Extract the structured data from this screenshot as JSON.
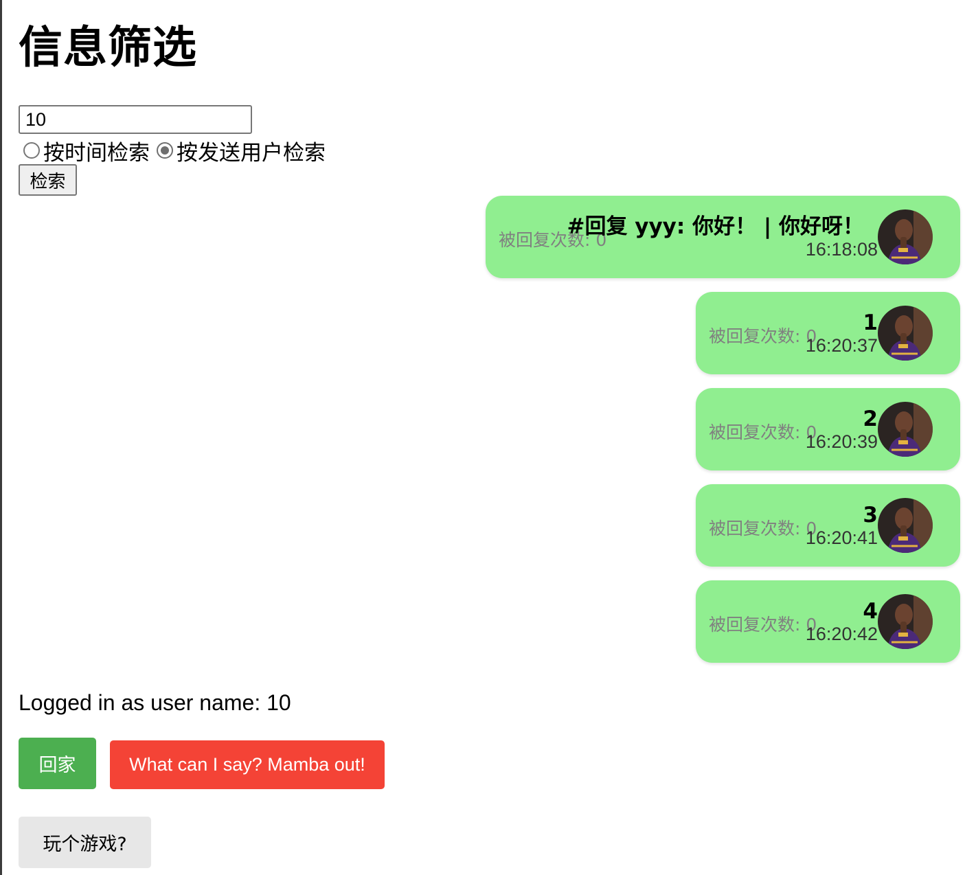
{
  "header": {
    "title": "信息筛选"
  },
  "search": {
    "value": "10",
    "mode_options": [
      {
        "label": "按时间检索",
        "checked": false
      },
      {
        "label": "按发送用户检索",
        "checked": true
      }
    ],
    "button_label": "检索"
  },
  "messages": [
    {
      "text": "#回复 yyy: 你好！ | 你好呀！",
      "time": "16:18:08",
      "reply_count": "被回复次数: 0"
    },
    {
      "text": "1",
      "time": "16:20:37",
      "reply_count": "被回复次数: 0"
    },
    {
      "text": "2",
      "time": "16:20:39",
      "reply_count": "被回复次数: 0"
    },
    {
      "text": "3",
      "time": "16:20:41",
      "reply_count": "被回复次数: 0"
    },
    {
      "text": "4",
      "time": "16:20:42",
      "reply_count": "被回复次数: 0"
    }
  ],
  "footer": {
    "login_status": "Logged in as user name: 10",
    "home_label": "回家",
    "mamba_label": "What can I say? Mamba out!",
    "game_label": "玩个游戏?"
  },
  "colors": {
    "bubble": "#90ee90",
    "home_button": "#4caf50",
    "mamba_button": "#f44336",
    "game_button": "#e7e7e7"
  }
}
